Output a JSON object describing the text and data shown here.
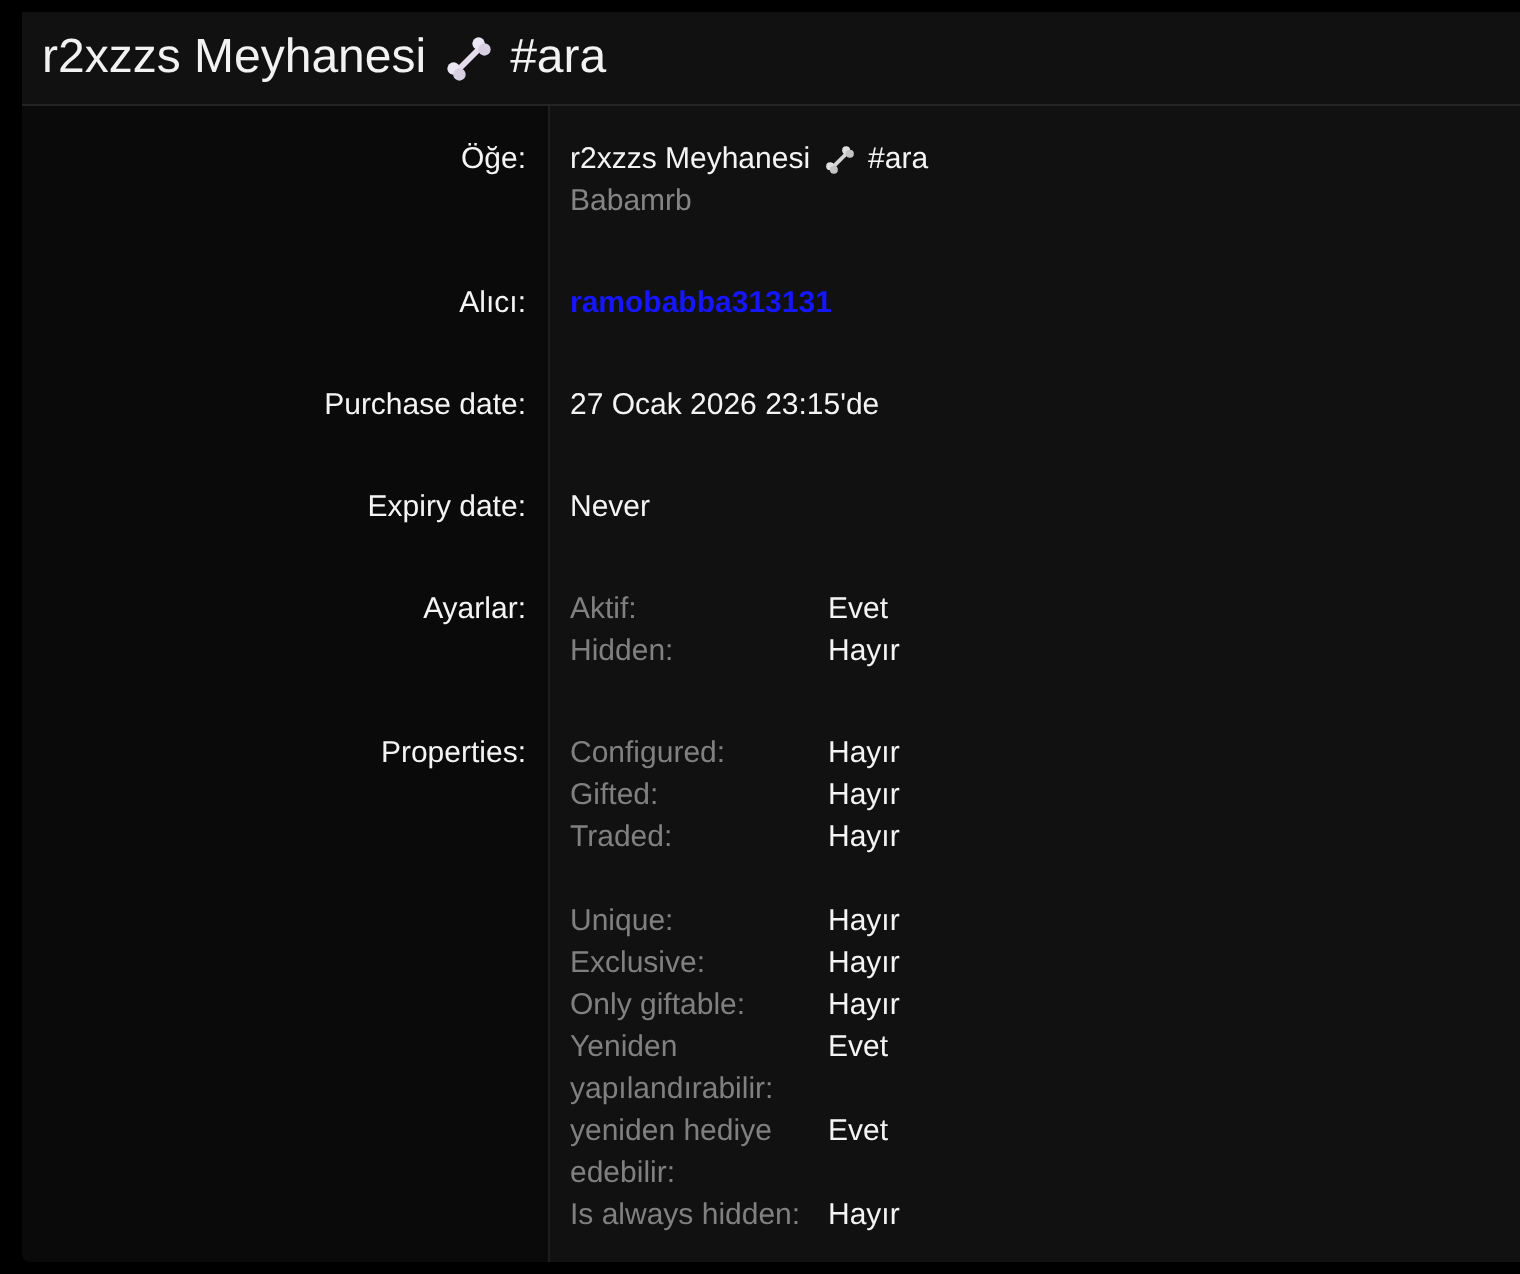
{
  "dialog": {
    "title": {
      "name": "r2xzzs Meyhanesi",
      "tag": "#ara"
    }
  },
  "fields": [
    {
      "label": "Öğe:",
      "kind": "item",
      "name": "r2xzzs Meyhanesi",
      "tag": "#ara",
      "owner": "Babamrb"
    },
    {
      "label": "Alıcı:",
      "kind": "link",
      "value": "ramobabba313131"
    },
    {
      "label": "Purchase date:",
      "kind": "text",
      "value": "27 Ocak 2026 23:15'de"
    },
    {
      "label": "Expiry date:",
      "kind": "text",
      "value": "Never"
    },
    {
      "label": "Ayarlar:",
      "kind": "table",
      "groups": [
        {
          "items": [
            {
              "key": "Aktif:",
              "value": "Evet"
            },
            {
              "key": "Hidden:",
              "value": "Hayır"
            }
          ]
        }
      ]
    },
    {
      "label": "Properties:",
      "kind": "table",
      "groups": [
        {
          "items": [
            {
              "key": "Configured:",
              "value": "Hayır"
            },
            {
              "key": "Gifted:",
              "value": "Hayır"
            },
            {
              "key": "Traded:",
              "value": "Hayır"
            }
          ]
        },
        {
          "items": [
            {
              "key": "Unique:",
              "value": "Hayır"
            },
            {
              "key": "Exclusive:",
              "value": "Hayır"
            },
            {
              "key": "Only giftable:",
              "value": "Hayır"
            },
            {
              "key": "Yeniden yapılandırabilir:",
              "value": "Evet"
            },
            {
              "key": "yeniden hediye edebilir:",
              "value": "Evet"
            },
            {
              "key": "Is always hidden:",
              "value": "Hayır"
            }
          ]
        }
      ]
    }
  ]
}
